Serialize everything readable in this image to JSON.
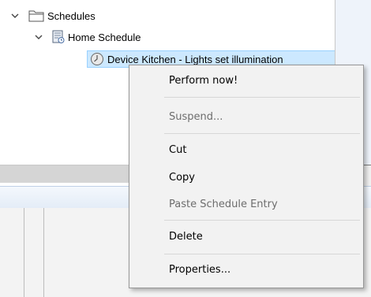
{
  "tree": {
    "schedules_label": "Schedules",
    "home_schedule_label": "Home Schedule",
    "entry_label": "Device Kitchen - Lights set illumination"
  },
  "context_menu": {
    "perform_now": "Perform now!",
    "suspend": "Suspend...",
    "cut": "Cut",
    "copy": "Copy",
    "paste": "Paste Schedule Entry",
    "delete": "Delete",
    "properties": "Properties..."
  },
  "icons": {
    "expand": "chevron-down-icon",
    "folder": "folder-icon",
    "schedule": "schedule-icon",
    "entry": "clock-icon"
  },
  "colors": {
    "selection": "#cce8ff",
    "menu_bg": "#f2f2f2",
    "disabled_text": "#6d6d6d"
  }
}
